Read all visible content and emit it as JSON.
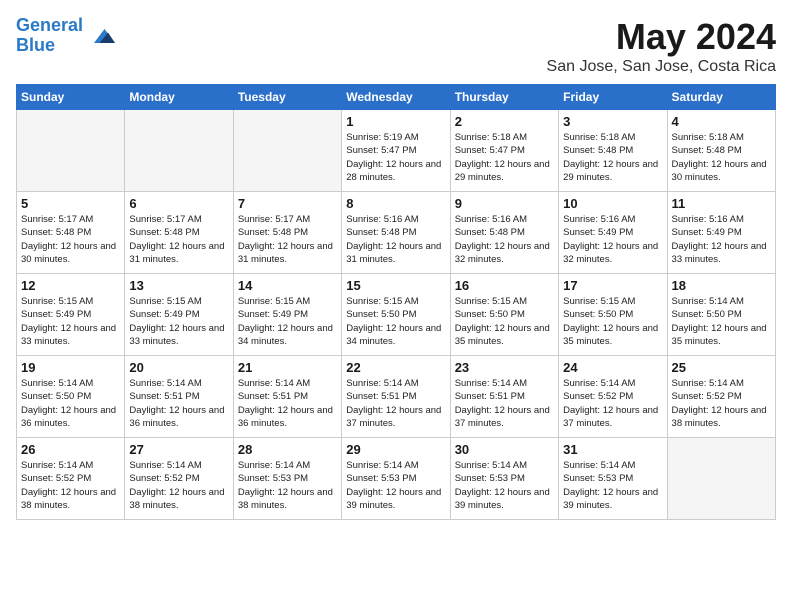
{
  "logo": {
    "line1": "General",
    "line2": "Blue"
  },
  "title": "May 2024",
  "location": "San Jose, San Jose, Costa Rica",
  "days_of_week": [
    "Sunday",
    "Monday",
    "Tuesday",
    "Wednesday",
    "Thursday",
    "Friday",
    "Saturday"
  ],
  "weeks": [
    [
      {
        "day": "",
        "info": ""
      },
      {
        "day": "",
        "info": ""
      },
      {
        "day": "",
        "info": ""
      },
      {
        "day": "1",
        "info": "Sunrise: 5:19 AM\nSunset: 5:47 PM\nDaylight: 12 hours\nand 28 minutes."
      },
      {
        "day": "2",
        "info": "Sunrise: 5:18 AM\nSunset: 5:47 PM\nDaylight: 12 hours\nand 29 minutes."
      },
      {
        "day": "3",
        "info": "Sunrise: 5:18 AM\nSunset: 5:48 PM\nDaylight: 12 hours\nand 29 minutes."
      },
      {
        "day": "4",
        "info": "Sunrise: 5:18 AM\nSunset: 5:48 PM\nDaylight: 12 hours\nand 30 minutes."
      }
    ],
    [
      {
        "day": "5",
        "info": "Sunrise: 5:17 AM\nSunset: 5:48 PM\nDaylight: 12 hours\nand 30 minutes."
      },
      {
        "day": "6",
        "info": "Sunrise: 5:17 AM\nSunset: 5:48 PM\nDaylight: 12 hours\nand 31 minutes."
      },
      {
        "day": "7",
        "info": "Sunrise: 5:17 AM\nSunset: 5:48 PM\nDaylight: 12 hours\nand 31 minutes."
      },
      {
        "day": "8",
        "info": "Sunrise: 5:16 AM\nSunset: 5:48 PM\nDaylight: 12 hours\nand 31 minutes."
      },
      {
        "day": "9",
        "info": "Sunrise: 5:16 AM\nSunset: 5:48 PM\nDaylight: 12 hours\nand 32 minutes."
      },
      {
        "day": "10",
        "info": "Sunrise: 5:16 AM\nSunset: 5:49 PM\nDaylight: 12 hours\nand 32 minutes."
      },
      {
        "day": "11",
        "info": "Sunrise: 5:16 AM\nSunset: 5:49 PM\nDaylight: 12 hours\nand 33 minutes."
      }
    ],
    [
      {
        "day": "12",
        "info": "Sunrise: 5:15 AM\nSunset: 5:49 PM\nDaylight: 12 hours\nand 33 minutes."
      },
      {
        "day": "13",
        "info": "Sunrise: 5:15 AM\nSunset: 5:49 PM\nDaylight: 12 hours\nand 33 minutes."
      },
      {
        "day": "14",
        "info": "Sunrise: 5:15 AM\nSunset: 5:49 PM\nDaylight: 12 hours\nand 34 minutes."
      },
      {
        "day": "15",
        "info": "Sunrise: 5:15 AM\nSunset: 5:50 PM\nDaylight: 12 hours\nand 34 minutes."
      },
      {
        "day": "16",
        "info": "Sunrise: 5:15 AM\nSunset: 5:50 PM\nDaylight: 12 hours\nand 35 minutes."
      },
      {
        "day": "17",
        "info": "Sunrise: 5:15 AM\nSunset: 5:50 PM\nDaylight: 12 hours\nand 35 minutes."
      },
      {
        "day": "18",
        "info": "Sunrise: 5:14 AM\nSunset: 5:50 PM\nDaylight: 12 hours\nand 35 minutes."
      }
    ],
    [
      {
        "day": "19",
        "info": "Sunrise: 5:14 AM\nSunset: 5:50 PM\nDaylight: 12 hours\nand 36 minutes."
      },
      {
        "day": "20",
        "info": "Sunrise: 5:14 AM\nSunset: 5:51 PM\nDaylight: 12 hours\nand 36 minutes."
      },
      {
        "day": "21",
        "info": "Sunrise: 5:14 AM\nSunset: 5:51 PM\nDaylight: 12 hours\nand 36 minutes."
      },
      {
        "day": "22",
        "info": "Sunrise: 5:14 AM\nSunset: 5:51 PM\nDaylight: 12 hours\nand 37 minutes."
      },
      {
        "day": "23",
        "info": "Sunrise: 5:14 AM\nSunset: 5:51 PM\nDaylight: 12 hours\nand 37 minutes."
      },
      {
        "day": "24",
        "info": "Sunrise: 5:14 AM\nSunset: 5:52 PM\nDaylight: 12 hours\nand 37 minutes."
      },
      {
        "day": "25",
        "info": "Sunrise: 5:14 AM\nSunset: 5:52 PM\nDaylight: 12 hours\nand 38 minutes."
      }
    ],
    [
      {
        "day": "26",
        "info": "Sunrise: 5:14 AM\nSunset: 5:52 PM\nDaylight: 12 hours\nand 38 minutes."
      },
      {
        "day": "27",
        "info": "Sunrise: 5:14 AM\nSunset: 5:52 PM\nDaylight: 12 hours\nand 38 minutes."
      },
      {
        "day": "28",
        "info": "Sunrise: 5:14 AM\nSunset: 5:53 PM\nDaylight: 12 hours\nand 38 minutes."
      },
      {
        "day": "29",
        "info": "Sunrise: 5:14 AM\nSunset: 5:53 PM\nDaylight: 12 hours\nand 39 minutes."
      },
      {
        "day": "30",
        "info": "Sunrise: 5:14 AM\nSunset: 5:53 PM\nDaylight: 12 hours\nand 39 minutes."
      },
      {
        "day": "31",
        "info": "Sunrise: 5:14 AM\nSunset: 5:53 PM\nDaylight: 12 hours\nand 39 minutes."
      },
      {
        "day": "",
        "info": ""
      }
    ]
  ]
}
